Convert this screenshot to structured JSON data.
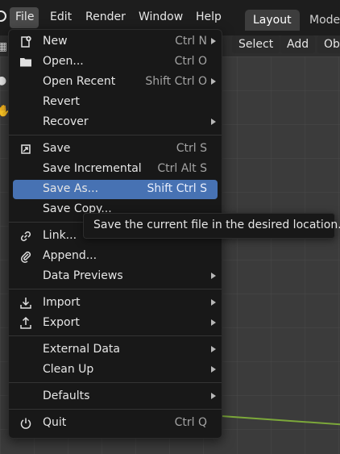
{
  "topbar": {
    "menus": [
      "File",
      "Edit",
      "Render",
      "Window",
      "Help"
    ],
    "workspace_tabs": [
      "Layout",
      "Model"
    ]
  },
  "header_buttons": [
    "Select",
    "Add",
    "Ob"
  ],
  "file_menu": {
    "items": [
      {
        "label": "New",
        "shortcut": "Ctrl N",
        "submenu": true,
        "icon": "new-file-icon"
      },
      {
        "label": "Open...",
        "shortcut": "Ctrl O",
        "submenu": false,
        "icon": "folder-icon"
      },
      {
        "label": "Open Recent",
        "shortcut": "Shift Ctrl O",
        "submenu": true,
        "icon": ""
      },
      {
        "label": "Revert",
        "shortcut": "",
        "submenu": false,
        "icon": ""
      },
      {
        "label": "Recover",
        "shortcut": "",
        "submenu": true,
        "icon": ""
      },
      {
        "label": "Save",
        "shortcut": "Ctrl S",
        "submenu": false,
        "icon": "save-icon"
      },
      {
        "label": "Save Incremental",
        "shortcut": "Ctrl Alt S",
        "submenu": false,
        "icon": ""
      },
      {
        "label": "Save As...",
        "shortcut": "Shift Ctrl S",
        "submenu": false,
        "icon": "",
        "selected": true
      },
      {
        "label": "Save Copy...",
        "shortcut": "",
        "submenu": false,
        "icon": ""
      },
      {
        "label": "Link...",
        "shortcut": "",
        "submenu": false,
        "icon": "link-icon"
      },
      {
        "label": "Append...",
        "shortcut": "",
        "submenu": false,
        "icon": "paperclip-icon"
      },
      {
        "label": "Data Previews",
        "shortcut": "",
        "submenu": true,
        "icon": ""
      },
      {
        "label": "Import",
        "shortcut": "",
        "submenu": true,
        "icon": "import-icon"
      },
      {
        "label": "Export",
        "shortcut": "",
        "submenu": true,
        "icon": "export-icon"
      },
      {
        "label": "External Data",
        "shortcut": "",
        "submenu": true,
        "icon": ""
      },
      {
        "label": "Clean Up",
        "shortcut": "",
        "submenu": true,
        "icon": ""
      },
      {
        "label": "Defaults",
        "shortcut": "",
        "submenu": true,
        "icon": ""
      },
      {
        "label": "Quit",
        "shortcut": "Ctrl Q",
        "submenu": false,
        "icon": "power-icon"
      }
    ]
  },
  "tooltip": "Save the current file in the desired location.",
  "colors": {
    "selection": "#4772b3",
    "menu_bg": "#181818",
    "axis_green": "#7ca83a"
  }
}
